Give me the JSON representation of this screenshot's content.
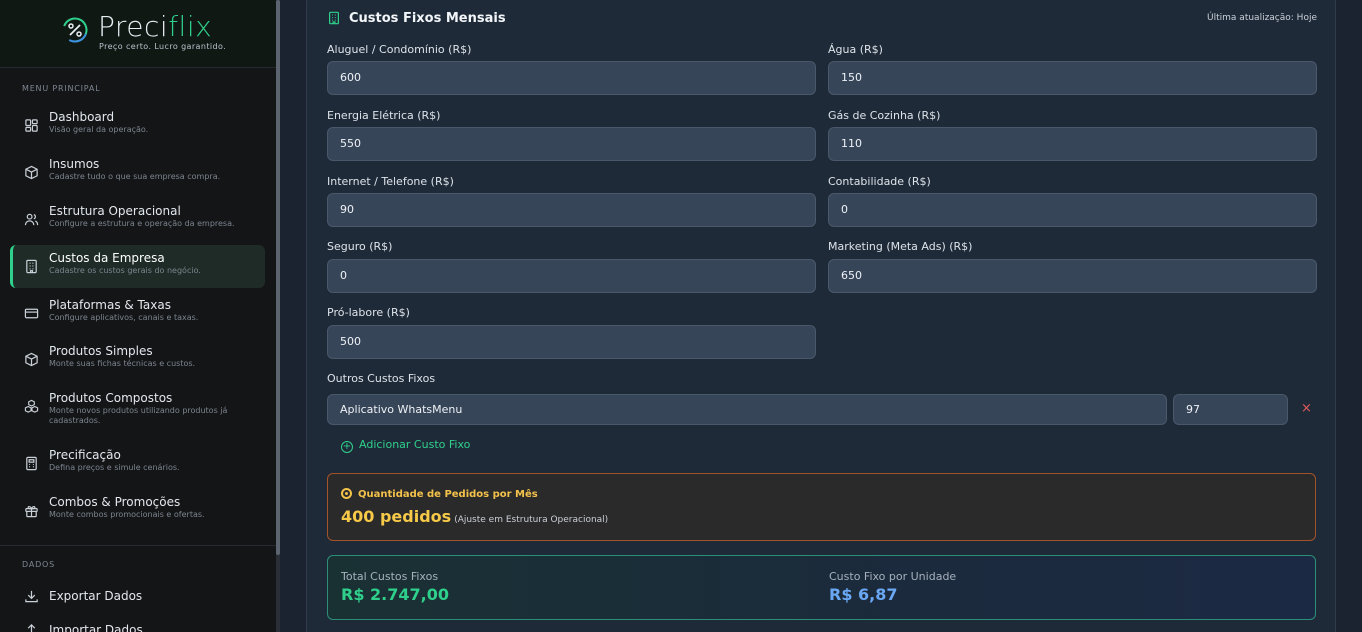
{
  "brand": {
    "name_part1": "Preci",
    "name_part2": "flix",
    "tagline": "Preço certo. Lucro garantido."
  },
  "sidebar": {
    "section_main": "MENU PRINCIPAL",
    "items": [
      {
        "label": "Dashboard",
        "desc": "Visão geral da operação.",
        "icon": "dashboard-icon"
      },
      {
        "label": "Insumos",
        "desc": "Cadastre tudo o que sua empresa compra.",
        "icon": "box-icon"
      },
      {
        "label": "Estrutura Operacional",
        "desc": "Configure a estrutura e operação da empresa.",
        "icon": "users-icon"
      },
      {
        "label": "Custos da Empresa",
        "desc": "Cadastre os custos gerais do negócio.",
        "icon": "building-icon",
        "active": true
      },
      {
        "label": "Plataformas & Taxas",
        "desc": "Configure aplicativos, canais e taxas.",
        "icon": "card-icon"
      },
      {
        "label": "Produtos Simples",
        "desc": "Monte suas fichas técnicas e custos.",
        "icon": "cube-icon"
      },
      {
        "label": "Produtos Compostos",
        "desc": "Monte novos produtos utilizando produtos já cadastrados.",
        "icon": "cubes-icon"
      },
      {
        "label": "Precificação",
        "desc": "Defina preços e simule cenários.",
        "icon": "calculator-icon"
      },
      {
        "label": "Combos & Promoções",
        "desc": "Monte combos promocionais e ofertas.",
        "icon": "gift-icon"
      }
    ],
    "section_data": "DADOS",
    "data_items": [
      {
        "label": "Exportar Dados",
        "icon": "download-icon"
      },
      {
        "label": "Importar Dados",
        "icon": "upload-icon"
      }
    ]
  },
  "card": {
    "title": "Custos Fixos Mensais",
    "last_update": "Última atualização: Hoje",
    "fields": {
      "aluguel": {
        "label": "Aluguel / Condomínio (R$)",
        "value": "600"
      },
      "agua": {
        "label": "Água (R$)",
        "value": "150"
      },
      "energia": {
        "label": "Energia Elétrica (R$)",
        "value": "550"
      },
      "gas": {
        "label": "Gás de Cozinha (R$)",
        "value": "110"
      },
      "internet": {
        "label": "Internet / Telefone (R$)",
        "value": "90"
      },
      "contabilidade": {
        "label": "Contabilidade (R$)",
        "value": "0"
      },
      "seguro": {
        "label": "Seguro (R$)",
        "value": "0"
      },
      "marketing": {
        "label": "Marketing (Meta Ads) (R$)",
        "value": "650"
      },
      "prolabore": {
        "label": "Pró-labore (R$)",
        "value": "500"
      }
    },
    "others": {
      "label": "Outros Custos Fixos",
      "items": [
        {
          "name": "Aplicativo WhatsMenu",
          "value": "97",
          "remove": "×"
        }
      ],
      "add_label": "Adicionar Custo Fixo"
    },
    "orders": {
      "title": "Quantidade de Pedidos por Mês",
      "value": "400 pedidos",
      "hint": "(Ajuste em Estrutura Operacional)"
    },
    "totals": {
      "total_label": "Total Custos Fixos",
      "total_value": "R$ 2.747,00",
      "unit_label": "Custo Fixo por Unidade",
      "unit_value": "R$ 6,87"
    }
  },
  "colors": {
    "accent": "#2fd08c",
    "warning": "#f7c948",
    "info": "#6aa8f5",
    "danger": "#e25c5c"
  }
}
